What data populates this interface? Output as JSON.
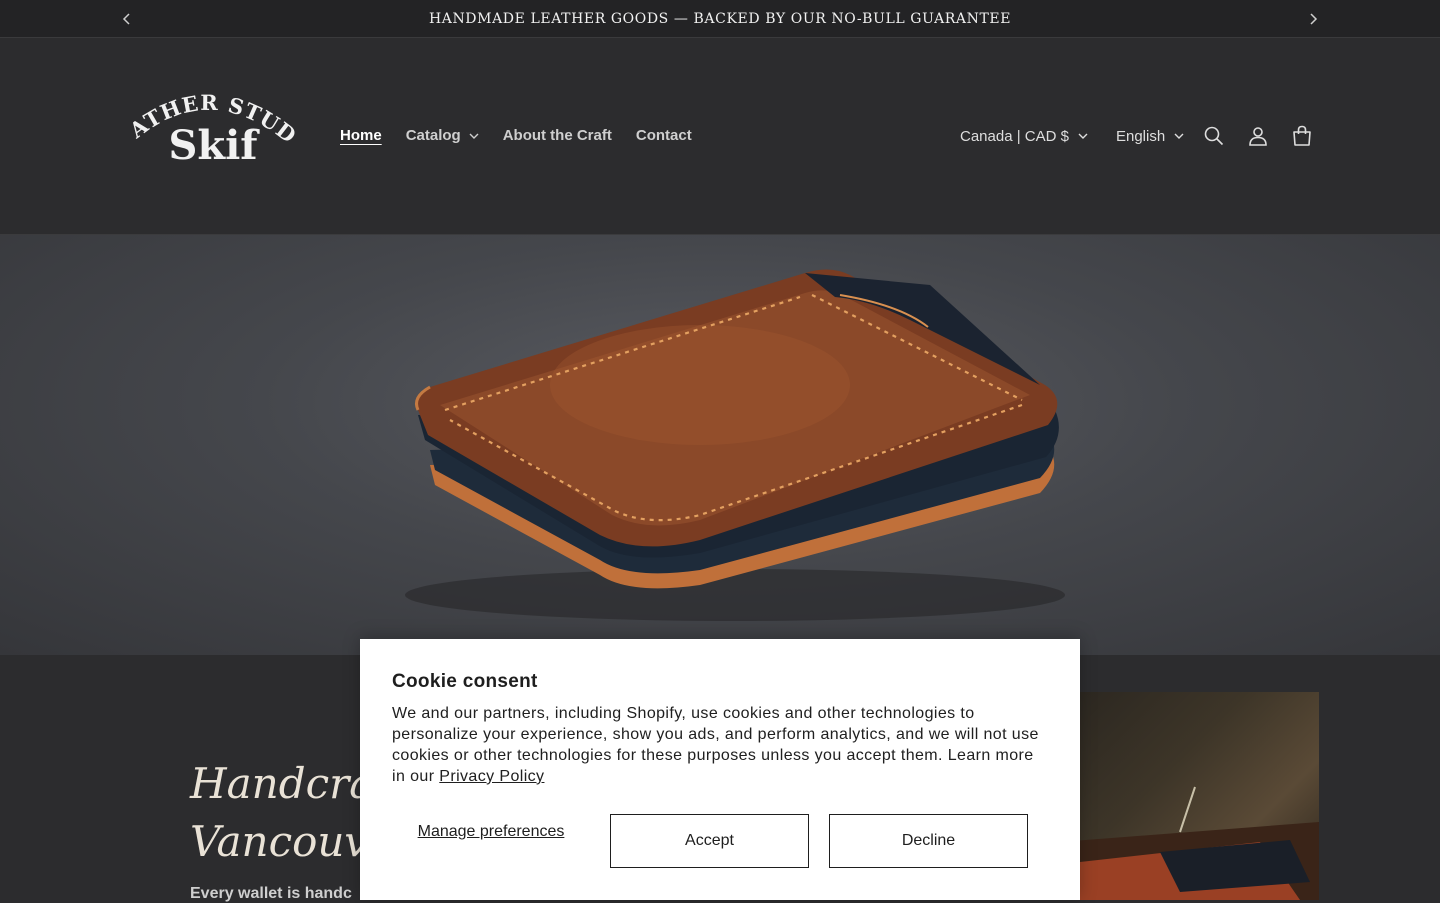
{
  "announcement": {
    "text": "HANDMADE LEATHER GOODS — BACKED BY OUR NO-BULL GUARANTEE",
    "prev_icon": "chevron-left-icon",
    "next_icon": "chevron-right-icon"
  },
  "header": {
    "logo": {
      "line1": "LEATHER STUDIO",
      "line2": "Skif"
    },
    "nav": [
      {
        "label": "Home",
        "active": true
      },
      {
        "label": "Catalog",
        "has_dropdown": true
      },
      {
        "label": "About the Craft"
      },
      {
        "label": "Contact"
      }
    ],
    "country_selector": "Canada | CAD $",
    "language_selector": "English",
    "icons": [
      "search-icon",
      "account-icon",
      "cart-icon"
    ]
  },
  "hero": {
    "image": "leather-wallet-photo"
  },
  "intro": {
    "headline_line1": "Handcraf",
    "headline_line2": "Vancouve",
    "subtext": "Every wallet is handc"
  },
  "cookie_consent": {
    "title": "Cookie consent",
    "body": "We and our partners, including Shopify, use cookies and other technologies to personalize your experience, show you ads, and perform analytics, and we will not use cookies or other technologies for these purposes unless you accept them. Learn more in our ",
    "privacy_link": "Privacy Policy",
    "manage_label": "Manage preferences",
    "accept_label": "Accept",
    "decline_label": "Decline"
  },
  "colors": {
    "background": "#2c2c2e",
    "announcement_bg": "#232325",
    "modal_bg": "#ffffff",
    "leather": "#8a4a2c"
  }
}
